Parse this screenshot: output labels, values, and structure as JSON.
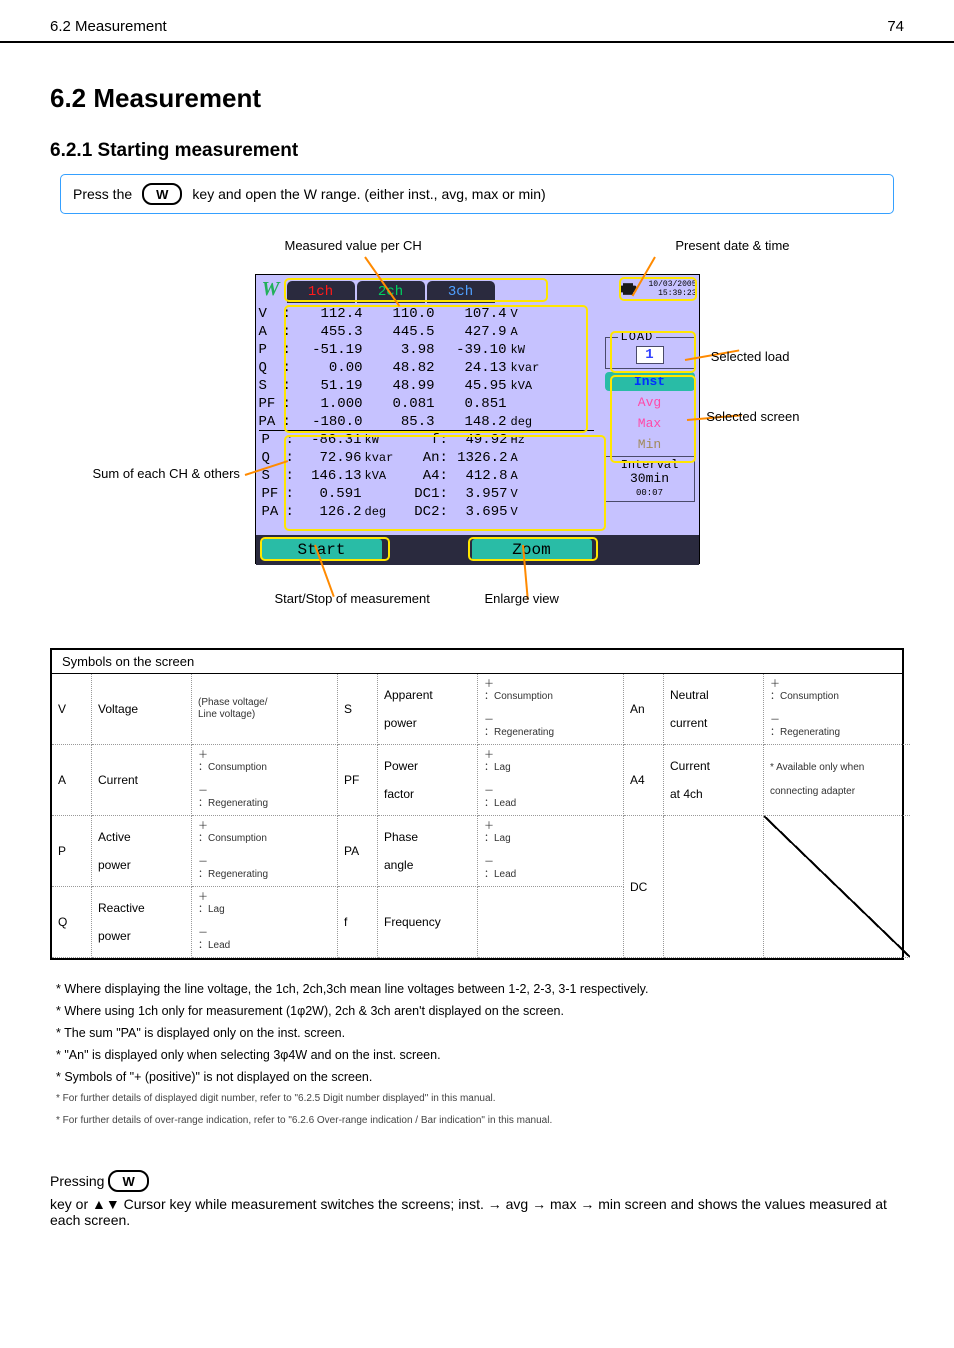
{
  "header": {
    "section_num": "6.2 Measurement",
    "page_num": "74"
  },
  "section_title": "6.2 Measurement",
  "subsection1": "6.2.1 Starting measurement",
  "instruct1": {
    "prefix": "Press the ",
    "key": "W",
    "suffix": " key and open the W range. (either inst., avg, max or min)"
  },
  "device": {
    "tabs": [
      "1ch",
      "2ch",
      "3ch"
    ],
    "date": "10/03/2005",
    "time": "15:39:23",
    "rows": [
      {
        "lab": "V",
        "c1": "112.4",
        "c2": "110.0",
        "c3": "107.4",
        "u": "V"
      },
      {
        "lab": "A",
        "c1": "455.3",
        "c2": "445.5",
        "c3": "427.9",
        "u": "A"
      },
      {
        "lab": "P",
        "c1": "-51.19",
        "c2": "3.98",
        "c3": "-39.10",
        "u": "kW"
      },
      {
        "lab": "Q",
        "c1": "0.00",
        "c2": "48.82",
        "c3": "24.13",
        "u": "kvar"
      },
      {
        "lab": "S",
        "c1": "51.19",
        "c2": "48.99",
        "c3": "45.95",
        "u": "kVA"
      },
      {
        "lab": "PF",
        "c1": "1.000",
        "c2": "0.081",
        "c3": "0.851",
        "u": ""
      },
      {
        "lab": "PA",
        "c1": "-180.0",
        "c2": "85.3",
        "c3": "148.2",
        "u": "deg"
      }
    ],
    "lower_left": [
      {
        "lab": "P",
        "val": "-86.31",
        "u": "kW"
      },
      {
        "lab": "Q",
        "val": "72.96",
        "u": "kvar"
      },
      {
        "lab": "S",
        "val": "146.13",
        "u": "kVA"
      },
      {
        "lab": "PF",
        "val": "0.591",
        "u": ""
      },
      {
        "lab": "PA",
        "val": "126.2",
        "u": "deg"
      }
    ],
    "lower_right": [
      {
        "lab": "f",
        "val": "49.92",
        "u": "Hz"
      },
      {
        "lab": "An",
        "val": "1326.2",
        "u": "A"
      },
      {
        "lab": "A4",
        "val": "412.8",
        "u": "A"
      },
      {
        "lab": "DC1",
        "val": "3.957",
        "u": "V"
      },
      {
        "lab": "DC2",
        "val": "3.695",
        "u": "V"
      }
    ],
    "load": {
      "legend": "LOAD",
      "num": "1"
    },
    "modes": [
      {
        "label": "Inst",
        "active": true
      },
      {
        "label": "Avg",
        "active": false
      },
      {
        "label": "Max",
        "active": false
      },
      {
        "label": "Min",
        "active": false,
        "gray": true
      }
    ],
    "interval": {
      "title": "Interval",
      "value": "30min",
      "elapsed": "00:07"
    },
    "buttons": {
      "start": "Start",
      "zoom": "Zoom"
    }
  },
  "callouts": {
    "ch": "Measured value per CH",
    "datetime": "Present date & time",
    "load": "Selected load",
    "screen": "Selected screen",
    "sum": "Sum of each CH & others",
    "start": "Start/Stop of measurement",
    "zoom": "Enlarge view"
  },
  "table": {
    "title": "Symbols on the screen",
    "rows": [
      [
        {
          "sym": "V",
          "name": "Voltage",
          "detail": [
            "(Phase voltage/",
            "Line voltage)"
          ]
        },
        {
          "sym": "S",
          "name": "Apparent",
          "name2": "power",
          "detail": [
            "：Consumption",
            "：Regenerating"
          ]
        },
        {
          "sym": "An",
          "name": "Neutral",
          "name2": "current",
          "detail": [
            "：Consumption",
            "：Regenerating"
          ]
        }
      ],
      [
        {
          "sym": "A",
          "name": "Current",
          "detail": [
            "：Consumption",
            "：Regenerating"
          ]
        },
        {
          "sym": "PF",
          "name": "Power",
          "name2": "factor",
          "detail": [
            "：Lag",
            "：Lead"
          ]
        },
        {
          "sym": "A4",
          "name": "Current",
          "name2": "at 4ch",
          "detail": [
            "* Available only when",
            "connecting adapter"
          ]
        }
      ],
      [
        {
          "sym": "P",
          "name": "Active",
          "name2": "power",
          "detail": [
            "：Consumption",
            "：Regenerating"
          ]
        },
        {
          "sym": "PA",
          "name": "Phase",
          "name2": "angle",
          "detail": [
            "：Lag",
            "：Lead"
          ]
        },
        {
          "sym": "DC",
          "name": "",
          "detail": [],
          "diag": true
        }
      ],
      [
        {
          "sym": "Q",
          "name": "Reactive",
          "name2": "power",
          "detail": [
            "：Lag",
            "：Lead"
          ]
        },
        {
          "sym": "f",
          "name": "Frequency",
          "detail": [
            ""
          ]
        },
        {
          "sym": "",
          "name": "",
          "detail": [],
          "diag": true
        }
      ]
    ]
  },
  "notes": [
    "* Where displaying the line voltage, the 1ch, 2ch,3ch mean line voltages between 1-2, 2-3, 3-1 respectively.",
    "* Where using 1ch only for measurement (1φ2W), 2ch & 3ch aren't displayed on the screen.",
    "* The sum \"PA\" is displayed only on the inst. screen.",
    "* \"An\" is displayed only when selecting 3φ4W and on the inst. screen.",
    "* Symbols of \"+ (positive)\" is not displayed on the screen."
  ],
  "ref1": "* For further details of displayed digit number, refer to \"6.2.5 Digit number displayed\" in this manual.",
  "ref2": "* For further details of over-range indication, refer to \"6.2.6 Over-range indication / Bar indication\" in this manual.",
  "footer": {
    "t1": "Pressing ",
    "key": "W",
    "t2": " key or ▲▼ Cursor key while measurement switches the screens; inst. → avg → max → min screen and shows the values measured at each screen."
  }
}
